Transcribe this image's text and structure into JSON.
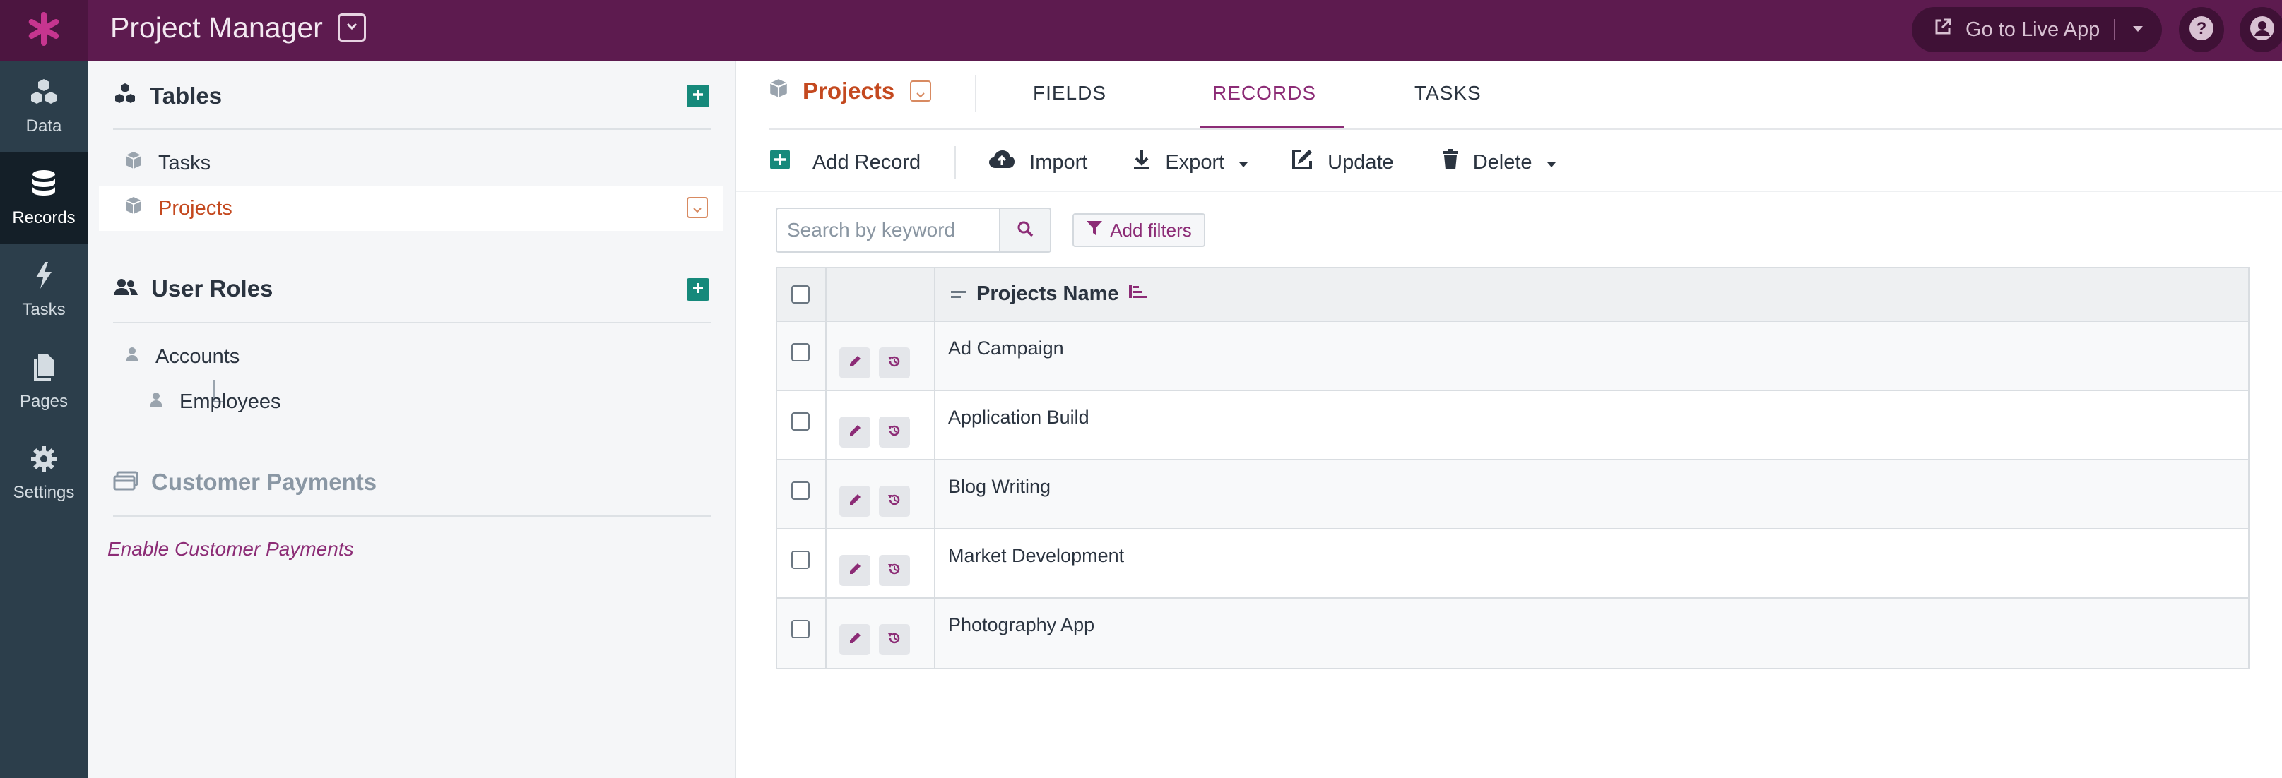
{
  "app": {
    "title": "Project Manager",
    "live_app_label": "Go to Live App",
    "accent": "#5d1b4f",
    "logo_icon": "asterisk-icon"
  },
  "rail": {
    "items": [
      {
        "label": "Data",
        "icon": "data-icon"
      },
      {
        "label": "Records",
        "icon": "database-icon",
        "active": true
      },
      {
        "label": "Tasks",
        "icon": "bolt-icon"
      },
      {
        "label": "Pages",
        "icon": "pages-icon"
      },
      {
        "label": "Settings",
        "icon": "gear-icon"
      }
    ]
  },
  "sidebar": {
    "tables_title": "Tables",
    "tables": [
      {
        "label": "Tasks"
      },
      {
        "label": "Projects",
        "selected": true
      }
    ],
    "roles_title": "User Roles",
    "roles": [
      {
        "label": "Accounts"
      },
      {
        "label": "Employees"
      }
    ],
    "payments_title": "Customer Payments",
    "enable_payments": "Enable Customer Payments"
  },
  "main": {
    "table_name": "Projects",
    "tabs": [
      {
        "label": "FIELDS"
      },
      {
        "label": "RECORDS",
        "active": true
      },
      {
        "label": "TASKS"
      }
    ],
    "toolbar": {
      "add": "Add Record",
      "import": "Import",
      "export": "Export",
      "update": "Update",
      "delete": "Delete"
    },
    "search": {
      "placeholder": "Search by keyword"
    },
    "filters_label": "Add filters",
    "grid": {
      "column": "Projects Name",
      "rows": [
        "Ad Campaign",
        "Application Build",
        "Blog Writing",
        "Market Development",
        "Photography App"
      ]
    }
  }
}
